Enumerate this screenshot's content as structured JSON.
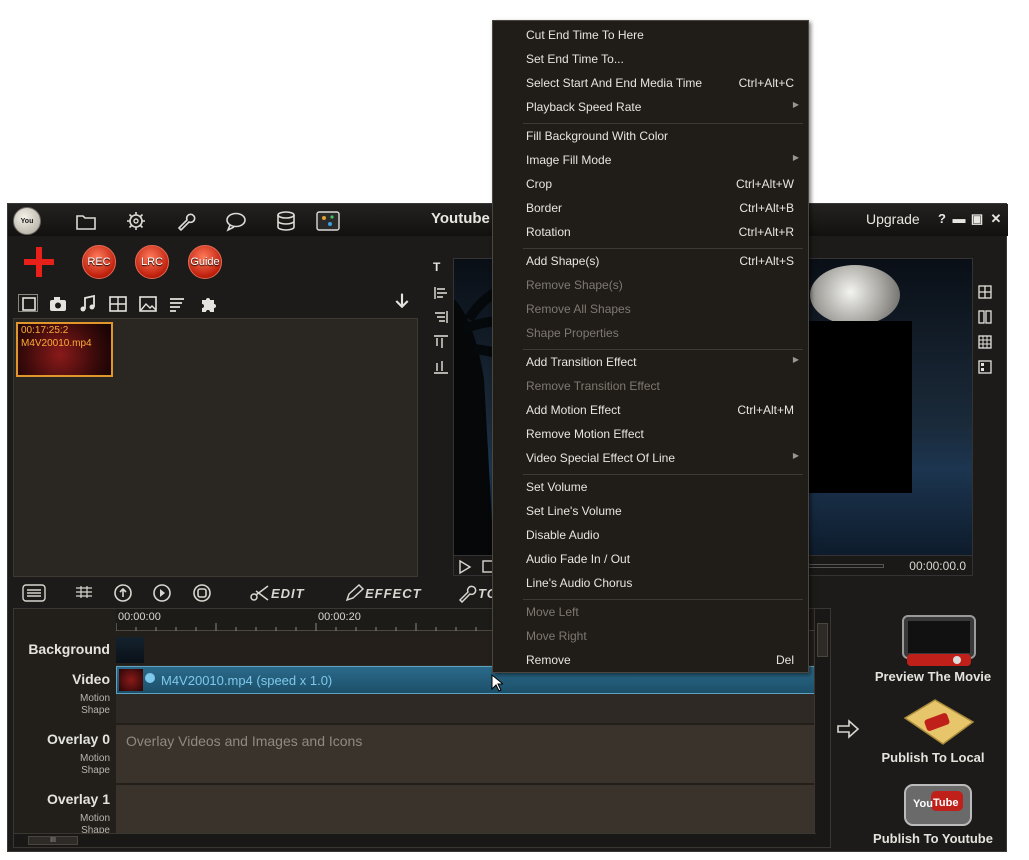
{
  "app": {
    "title": "Youtube",
    "logo_text": "You",
    "upgrade_label": "Upgrade",
    "help_label": "?",
    "minimize_label": "▬",
    "maximize_label": "▣",
    "close_label": "✕"
  },
  "toolbar_icons": [
    "folder-icon",
    "gear-icon",
    "wrench-icon",
    "chat-icon",
    "database-icon",
    "palette-icon"
  ],
  "action_buttons": [
    {
      "label": "REC"
    },
    {
      "label": "LRC"
    },
    {
      "label": "Guide"
    }
  ],
  "media_tabs": [
    "video-icon",
    "camera-icon",
    "music-icon",
    "filmstrip-icon",
    "image-icon",
    "text-lines-icon",
    "puzzle-icon"
  ],
  "media_items": [
    {
      "time": "00:17:25:2",
      "name": "M4V20010.mp4"
    }
  ],
  "preview": {
    "time": "00:00:00.0"
  },
  "toolbar2": {
    "edit_label": "EDIT",
    "effect_label": "EFFECT",
    "tools_label": "TO"
  },
  "timeline": {
    "ruler": [
      "00:00:00",
      "00:00:20"
    ],
    "tracks": [
      {
        "label": "Background",
        "sub": ""
      },
      {
        "label": "Video",
        "sub": "Motion\nShape"
      },
      {
        "label": "Overlay 0",
        "sub": "Motion\nShape"
      },
      {
        "label": "Overlay 1",
        "sub": "Motion\nShape"
      }
    ],
    "video_clip_label": "M4V20010.mp4  (speed x 1.0)",
    "overlay_hint": "Overlay Videos and Images and Icons",
    "scroll_label": "III"
  },
  "side_actions": [
    {
      "label": "Preview The Movie"
    },
    {
      "label": "Publish To Local"
    },
    {
      "label": "Publish To Youtube"
    }
  ],
  "context_menu": [
    {
      "label": "Cut End Time To Here",
      "shortcut": "",
      "submenu": false,
      "disabled": false
    },
    {
      "label": "Set End Time To...",
      "shortcut": "",
      "submenu": false,
      "disabled": false
    },
    {
      "label": "Select Start And End Media Time",
      "shortcut": "Ctrl+Alt+C",
      "submenu": false,
      "disabled": false
    },
    {
      "label": "Playback Speed Rate",
      "shortcut": "",
      "submenu": true,
      "disabled": false
    },
    {
      "sep": true
    },
    {
      "label": "Fill Background With Color",
      "shortcut": "",
      "submenu": false,
      "disabled": false
    },
    {
      "label": "Image Fill Mode",
      "shortcut": "",
      "submenu": true,
      "disabled": false
    },
    {
      "label": "Crop",
      "shortcut": "Ctrl+Alt+W",
      "submenu": false,
      "disabled": false
    },
    {
      "label": "Border",
      "shortcut": "Ctrl+Alt+B",
      "submenu": false,
      "disabled": false
    },
    {
      "label": "Rotation",
      "shortcut": "Ctrl+Alt+R",
      "submenu": false,
      "disabled": false
    },
    {
      "sep": true
    },
    {
      "label": "Add Shape(s)",
      "shortcut": "Ctrl+Alt+S",
      "submenu": false,
      "disabled": false
    },
    {
      "label": "Remove Shape(s)",
      "shortcut": "",
      "submenu": false,
      "disabled": true
    },
    {
      "label": "Remove All Shapes",
      "shortcut": "",
      "submenu": false,
      "disabled": true
    },
    {
      "label": "Shape Properties",
      "shortcut": "",
      "submenu": false,
      "disabled": true
    },
    {
      "sep": true
    },
    {
      "label": "Add Transition Effect",
      "shortcut": "",
      "submenu": true,
      "disabled": false
    },
    {
      "label": "Remove Transition Effect",
      "shortcut": "",
      "submenu": false,
      "disabled": true
    },
    {
      "label": "Add Motion Effect",
      "shortcut": "Ctrl+Alt+M",
      "submenu": false,
      "disabled": false
    },
    {
      "label": "Remove Motion Effect",
      "shortcut": "",
      "submenu": false,
      "disabled": false
    },
    {
      "label": "Video Special Effect Of Line",
      "shortcut": "",
      "submenu": true,
      "disabled": false
    },
    {
      "sep": true
    },
    {
      "label": "Set Volume",
      "shortcut": "",
      "submenu": false,
      "disabled": false
    },
    {
      "label": "Set Line's Volume",
      "shortcut": "",
      "submenu": false,
      "disabled": false
    },
    {
      "label": "Disable Audio",
      "shortcut": "",
      "submenu": false,
      "disabled": false
    },
    {
      "label": "Audio Fade In / Out",
      "shortcut": "",
      "submenu": false,
      "disabled": false
    },
    {
      "label": "Line's Audio Chorus",
      "shortcut": "",
      "submenu": false,
      "disabled": false
    },
    {
      "sep": true
    },
    {
      "label": "Move Left",
      "shortcut": "",
      "submenu": false,
      "disabled": true
    },
    {
      "label": "Move Right",
      "shortcut": "",
      "submenu": false,
      "disabled": true
    },
    {
      "label": "Remove",
      "shortcut": "Del",
      "submenu": false,
      "disabled": false
    }
  ]
}
